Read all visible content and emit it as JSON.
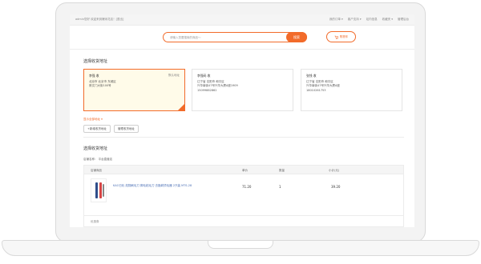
{
  "topbar": {
    "welcome": "admin您好 欢迎来到爆米花店！[退出]",
    "links": [
      "我的订单 ▾",
      "客户支持 ▾",
      "站内信息",
      "收藏夹 ▾",
      "管理后台"
    ]
  },
  "search": {
    "placeholder": "请输入您要搜索的商品～",
    "button": "搜索"
  },
  "cart": {
    "label": "购物车"
  },
  "address_section": {
    "title": "选择收货地址",
    "addresses": [
      {
        "name": "李强  收",
        "line1": "北京市  北京市  东城区",
        "line2": "崇文门大街100号",
        "line3": "",
        "default_label": "默认地址",
        "edit": ""
      },
      {
        "name": "李强码  收",
        "line1": "辽宁省  沈阳市  和平区",
        "line2": "兴华南街47号兴华大厦A座1909",
        "line3": "15099882862",
        "default_label": "",
        "edit": ""
      },
      {
        "name": "张钱  收",
        "line1": "辽宁省  沈阳市  和平区",
        "line2": "兴华南街47号兴华大厦A座",
        "line3": "18010261753",
        "default_label": "",
        "edit": ""
      }
    ],
    "more_link": "显示全部地址 ▾",
    "add_button": "+新增收货地址",
    "manage_button": "管理收货地址"
  },
  "order_section": {
    "title": "选择收货地址",
    "shop": "店铺名称：  平台直营店",
    "columns": [
      "店铺商品",
      "单价",
      "数量",
      "小计(元)"
    ],
    "items": [
      {
        "name": "KAO日化 炫翔刷毛刀 脚毛粘毛刀 去脂剃须毛器 2只装 MTS-28",
        "price": "71.20",
        "qty": "1",
        "subtotal": "39.20"
      }
    ],
    "footer": "优惠券"
  },
  "colors": {
    "accent": "#f26b2a",
    "link": "#4a6fb5"
  }
}
